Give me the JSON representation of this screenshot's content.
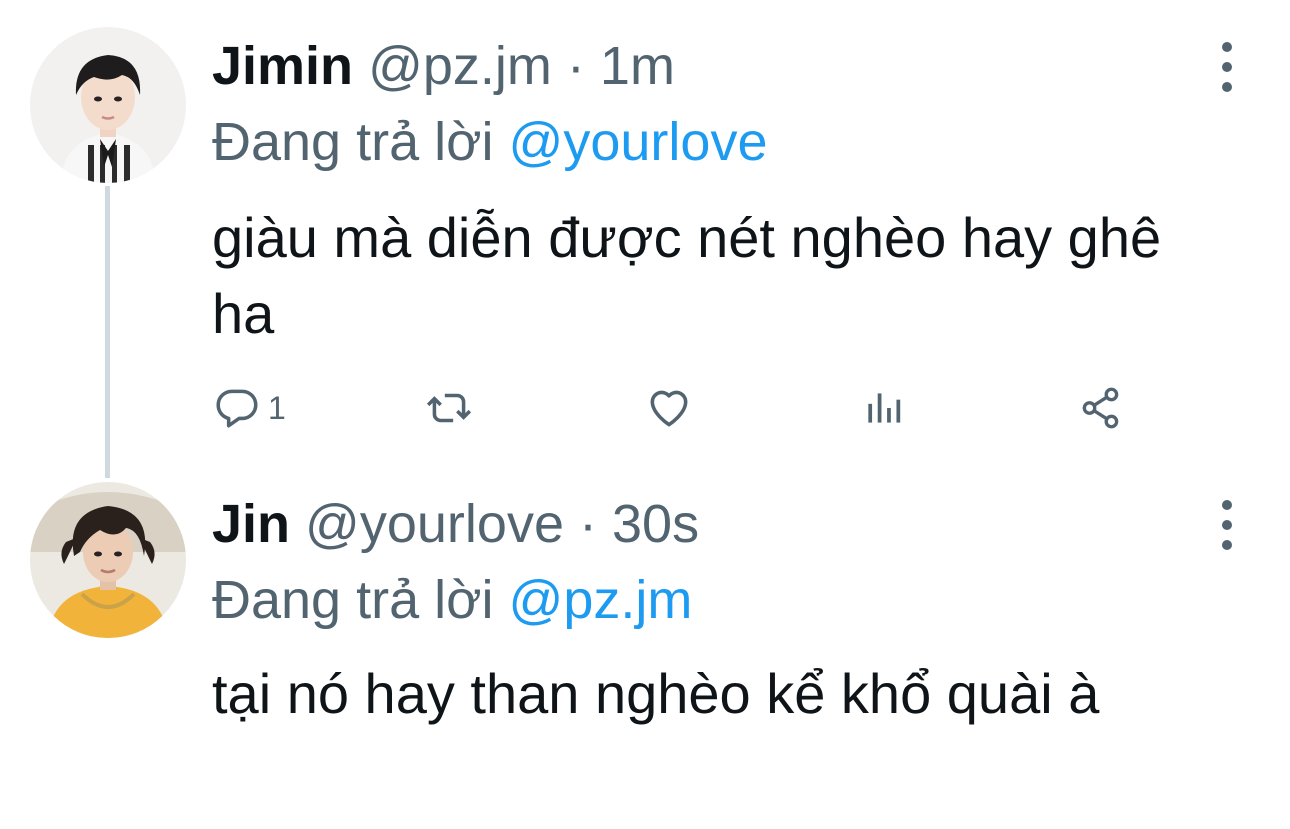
{
  "tweets": [
    {
      "name": "Jimin",
      "handle": "@pz.jm",
      "separator": "·",
      "time": "1m",
      "replying_label": "Đang trả lời",
      "replying_to": "@yourlove",
      "text": "giàu mà diễn được nét nghèo hay ghê ha",
      "reply_count": "1"
    },
    {
      "name": "Jin",
      "handle": "@yourlove",
      "separator": "·",
      "time": "30s",
      "replying_label": "Đang trả lời",
      "replying_to": "@pz.jm",
      "text": "tại nó hay than nghèo kể khổ quài à"
    }
  ],
  "icons": {
    "reply": "reply-icon",
    "retweet": "retweet-icon",
    "like": "heart-icon",
    "views": "views-icon",
    "share": "share-icon",
    "more": "more-vertical-icon"
  },
  "colors": {
    "text": "#0f1419",
    "secondary": "#536471",
    "accent": "#1d9bf0",
    "thread_line": "#cfd9de"
  }
}
